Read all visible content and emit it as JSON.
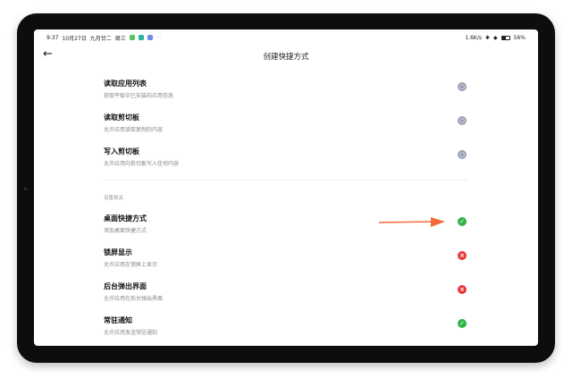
{
  "status_bar": {
    "time": "9:37",
    "date": "10月27日",
    "lunar": "九月廿二",
    "weekday": "周三",
    "more": "···",
    "speed": "1.6K/s",
    "battery": "56%"
  },
  "header": {
    "title": "创建快捷方式",
    "back_icon": "arrow-left-icon"
  },
  "section_label": "设置相关",
  "permissions": [
    {
      "title": "读取应用列表",
      "subtitle": "获取平板中已安装的应用信息",
      "status": "neutral"
    },
    {
      "title": "读取剪切板",
      "subtitle": "允许应用读取复制的内容",
      "status": "neutral"
    },
    {
      "title": "写入剪切板",
      "subtitle": "允许应用向剪切板写入任何内容",
      "status": "neutral"
    },
    {
      "title": "桌面快捷方式",
      "subtitle": "添加桌面快捷方式",
      "status": "allowed"
    },
    {
      "title": "锁屏显示",
      "subtitle": "允许应用在锁屏上显示",
      "status": "denied"
    },
    {
      "title": "后台弹出界面",
      "subtitle": "允许应用在后台弹出界面",
      "status": "denied"
    },
    {
      "title": "常驻通知",
      "subtitle": "允许应用发送常驻通知",
      "status": "allowed"
    }
  ],
  "colors": {
    "neutral": "#9a9fb5",
    "allowed": "#2fb344",
    "denied": "#e5383b",
    "arrow": "#f26b3a"
  }
}
